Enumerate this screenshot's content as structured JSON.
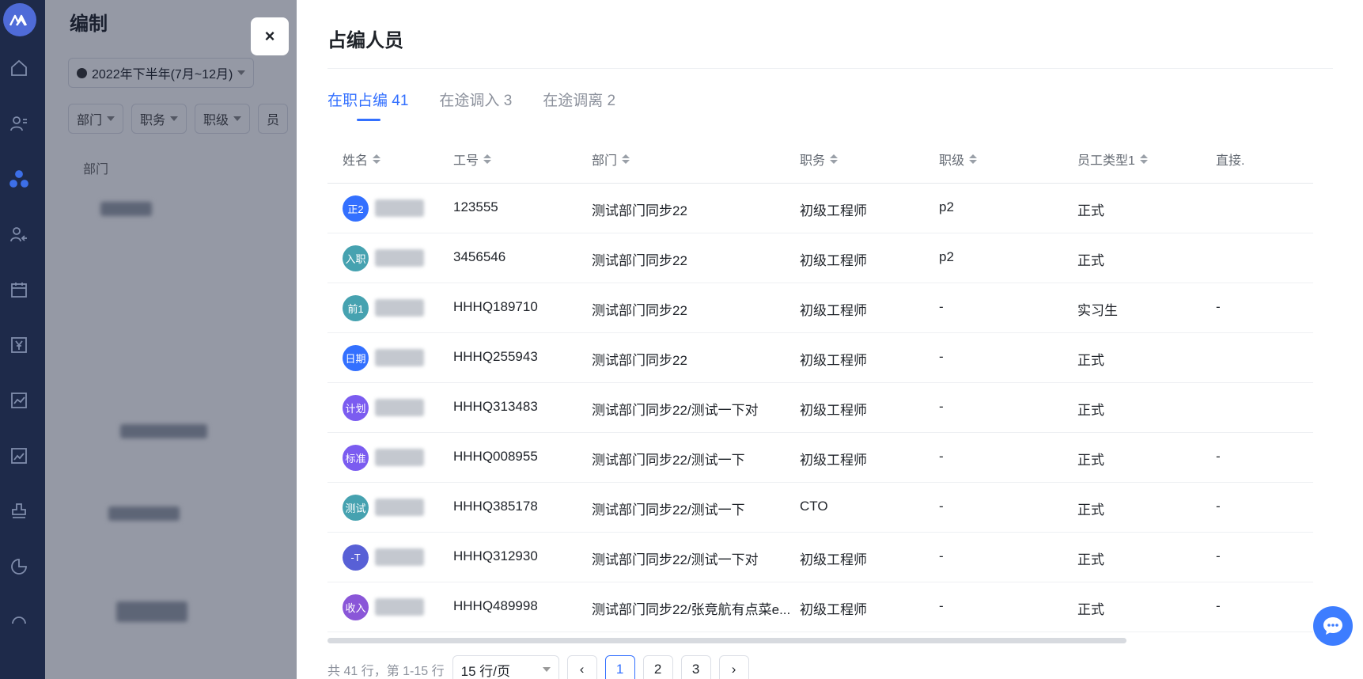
{
  "background": {
    "page_title": "编制",
    "period": "2022年下半年(7月~12月)",
    "filters": [
      "部门",
      "职务",
      "职级",
      "员"
    ],
    "column_header": "部门"
  },
  "drawer": {
    "title": "占编人员",
    "close_label": "×",
    "tabs": [
      {
        "label": "在职占编 41",
        "active": true
      },
      {
        "label": "在途调入 3",
        "active": false
      },
      {
        "label": "在途调离 2",
        "active": false
      }
    ],
    "columns": [
      "姓名",
      "工号",
      "部门",
      "职务",
      "职级",
      "员工类型1",
      "直接."
    ],
    "rows": [
      {
        "avatar": "正2",
        "avatar_color": "#3370ff",
        "id": "123555",
        "dept": "测试部门同步22",
        "position": "初级工程师",
        "level": "p2",
        "type": "正式",
        "direct": ""
      },
      {
        "avatar": "入职",
        "avatar_color": "#46a2b0",
        "id": "3456546",
        "dept": "测试部门同步22",
        "position": "初级工程师",
        "level": "p2",
        "type": "正式",
        "direct": ""
      },
      {
        "avatar": "前1",
        "avatar_color": "#46a2b0",
        "id": "HHHQ189710",
        "dept": "测试部门同步22",
        "position": "初级工程师",
        "level": "-",
        "type": "实习生",
        "direct": "-"
      },
      {
        "avatar": "日期",
        "avatar_color": "#3370ff",
        "id": "HHHQ255943",
        "dept": "测试部门同步22",
        "position": "初级工程师",
        "level": "-",
        "type": "正式",
        "direct": ""
      },
      {
        "avatar": "计划",
        "avatar_color": "#7b5cf0",
        "id": "HHHQ313483",
        "dept": "测试部门同步22/测试一下对",
        "position": "初级工程师",
        "level": "-",
        "type": "正式",
        "direct": ""
      },
      {
        "avatar": "标准",
        "avatar_color": "#7b5cf0",
        "id": "HHHQ008955",
        "dept": "测试部门同步22/测试一下",
        "position": "初级工程师",
        "level": "-",
        "type": "正式",
        "direct": "-"
      },
      {
        "avatar": "测试",
        "avatar_color": "#46a2b0",
        "id": "HHHQ385178",
        "dept": "测试部门同步22/测试一下",
        "position": "CTO",
        "level": "-",
        "type": "正式",
        "direct": "-"
      },
      {
        "avatar": "-T",
        "avatar_color": "#5860d6",
        "id": "HHHQ312930",
        "dept": "测试部门同步22/测试一下对",
        "position": "初级工程师",
        "level": "-",
        "type": "正式",
        "direct": "-"
      },
      {
        "avatar": "收入",
        "avatar_color": "#8a56d8",
        "id": "HHHQ489998",
        "dept": "测试部门同步22/张竞航有点菜e...",
        "position": "初级工程师",
        "level": "-",
        "type": "正式",
        "direct": "-"
      }
    ],
    "pagination": {
      "total_text": "共 41 行，第 1-15 行",
      "page_size": "15 行/页",
      "prev": "‹",
      "next": "›",
      "pages": [
        "1",
        "2",
        "3"
      ],
      "current": "1"
    }
  },
  "icons": [
    "logo-icon",
    "home-icon",
    "user-list-icon",
    "org-icon",
    "user-transfer-icon",
    "calendar-icon",
    "salary-icon",
    "report-icon",
    "chart-icon",
    "stamp-icon",
    "pie-icon",
    "chat-icon"
  ]
}
